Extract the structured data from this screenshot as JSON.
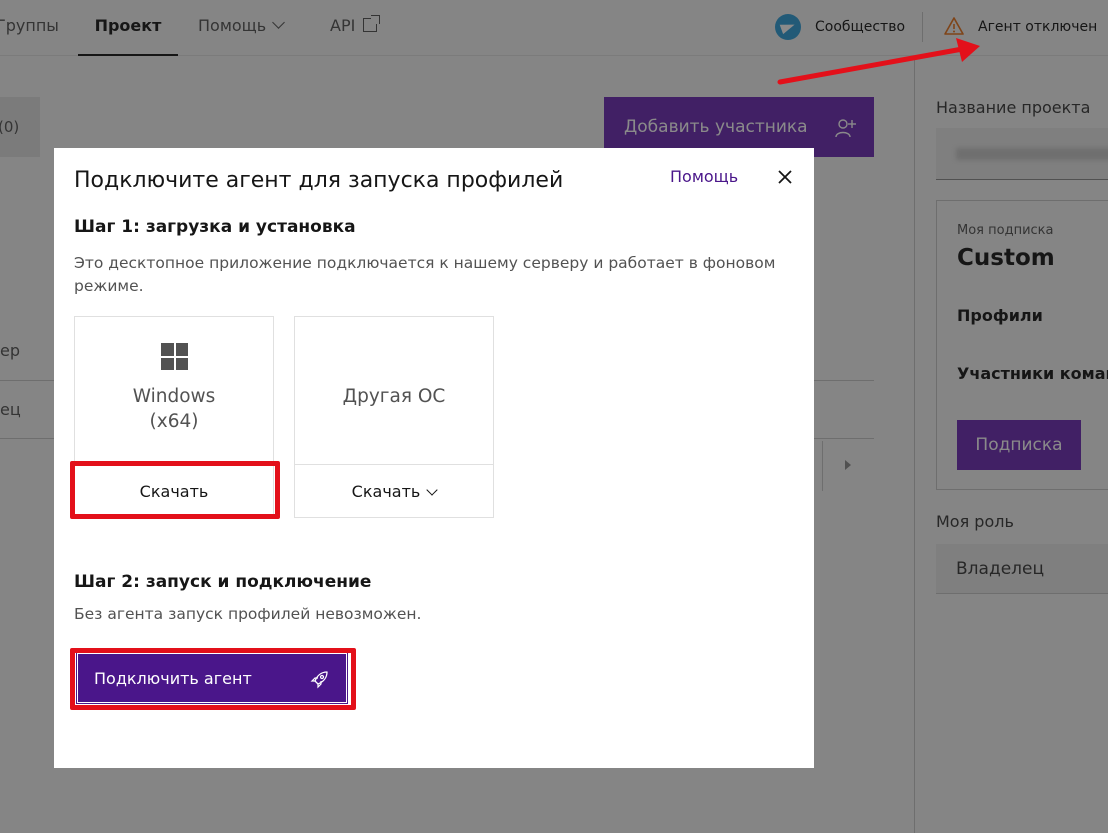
{
  "nav": {
    "groups": "Группы",
    "project": "Проект",
    "help": "Помощь",
    "api": "API",
    "community": "Сообщество",
    "agent_status": "Агент отключен"
  },
  "background": {
    "members_count": "(0)",
    "add_member": "Добавить участника",
    "row1_fragment": "ер",
    "row2_fragment": "ец"
  },
  "right_panel": {
    "project_name_label": "Название проекта",
    "subscription_label": "Моя подписка",
    "subscription_value": "Custom",
    "profiles_label": "Профили",
    "members_label": "Участники команды",
    "subscription_button": "Подписка",
    "role_label": "Моя роль",
    "role_value": "Владелец"
  },
  "modal": {
    "title": "Подключите агент для запуска профилей",
    "help": "Помощь",
    "step1_title": "Шаг 1: загрузка и установка",
    "step1_desc": "Это десктопное приложение подключается к нашему серверу и работает в фоновом режиме.",
    "os_windows_line1": "Windows",
    "os_windows_line2": "(x64)",
    "os_other": "Другая ОС",
    "download": "Скачать",
    "download_other": "Скачать",
    "step2_title": "Шаг 2: запуск и подключение",
    "step2_desc": "Без агента запуск профилей невозможен.",
    "connect_button": "Подключить агент"
  },
  "colors": {
    "brand_purple": "#4a168a",
    "highlight_red": "#e3101a",
    "telegram_blue": "#2f9ed8"
  }
}
